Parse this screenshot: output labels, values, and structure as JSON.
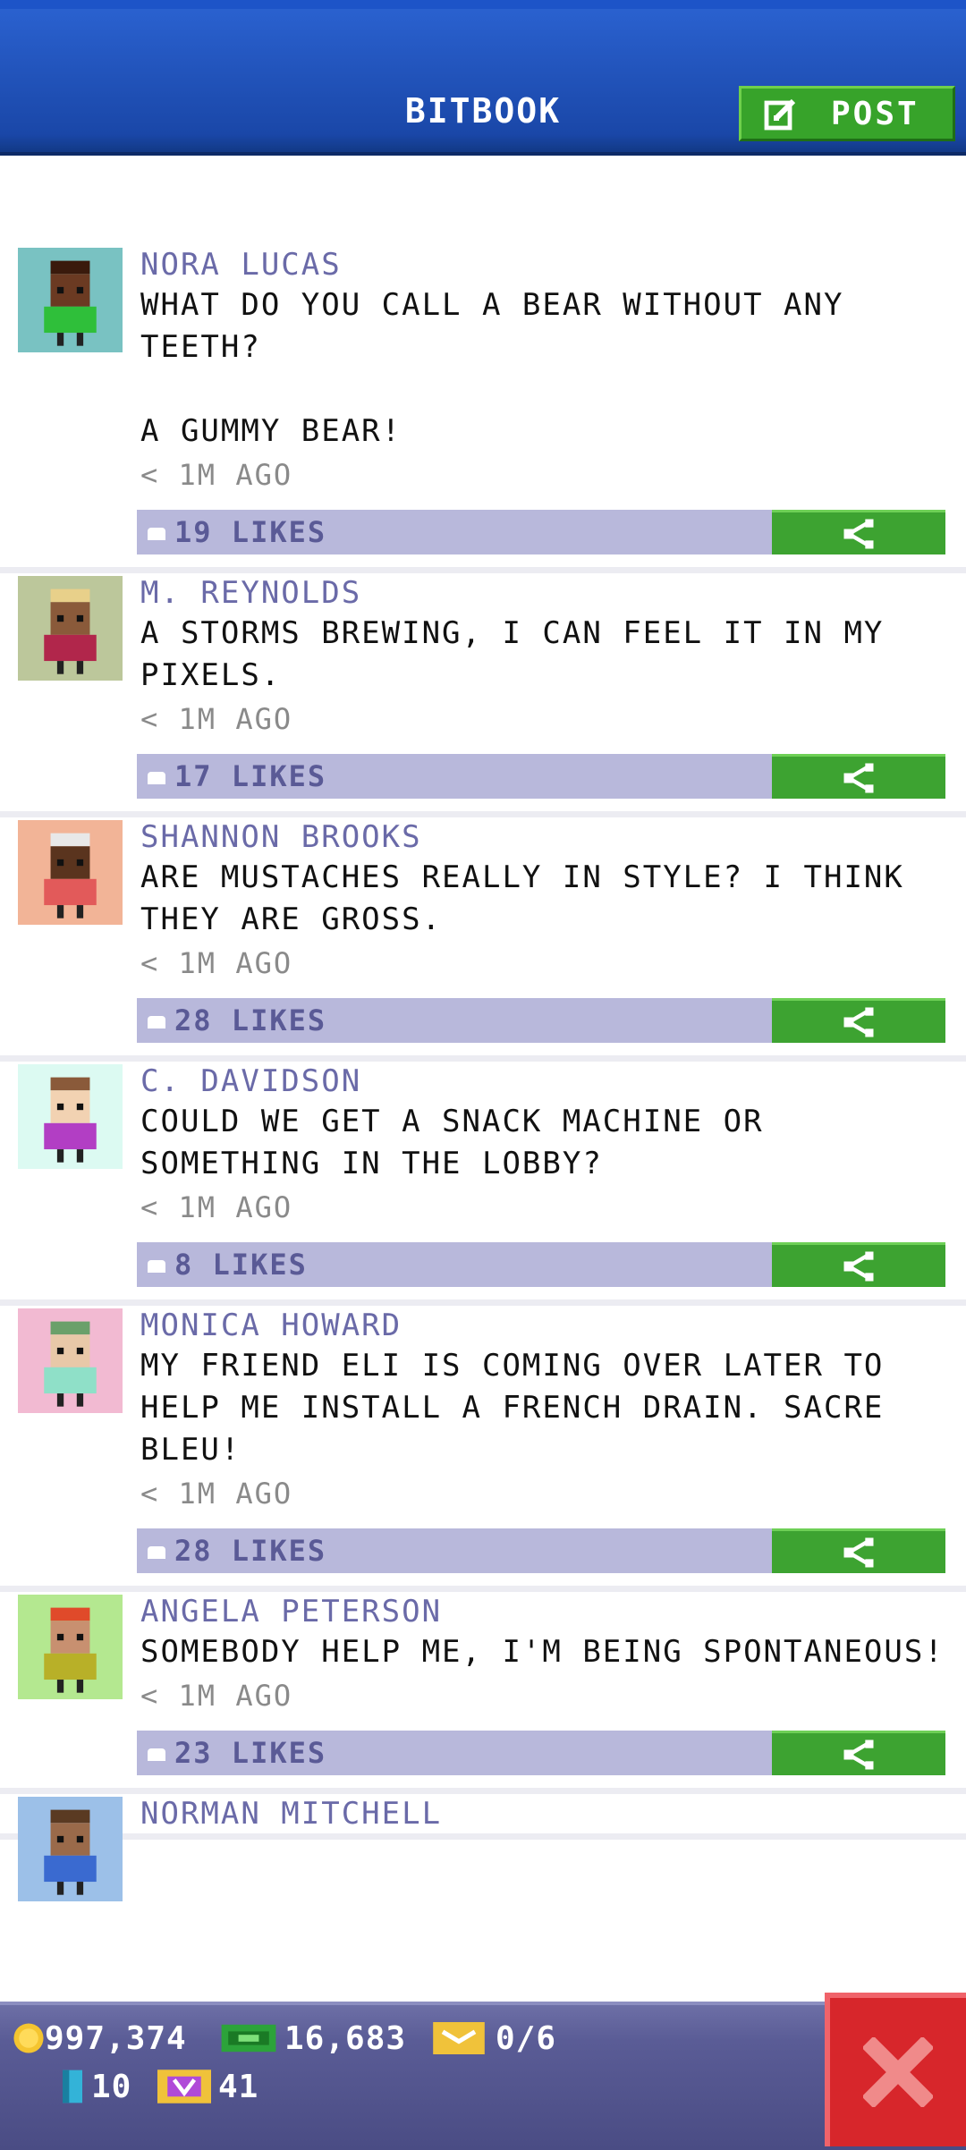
{
  "header": {
    "title": "BITBOOK",
    "post_label": "POST"
  },
  "posts": [
    {
      "author": "NORA LUCAS",
      "text": "WHAT DO YOU CALL A BEAR WITHOUT ANY TEETH?\n\nA GUMMY BEAR!",
      "time": "< 1M AGO",
      "likes": "19 LIKES",
      "avatar_bg": "#79c2c2",
      "shirt": "#2fbf3a",
      "skin": "#6b3a22",
      "hair": "#3a1a0c"
    },
    {
      "author": "M. REYNOLDS",
      "text": "A STORMS BREWING, I CAN FEEL IT IN MY PIXELS.",
      "time": "< 1M AGO",
      "likes": "17 LIKES",
      "avatar_bg": "#bcc79b",
      "shirt": "#b1264b",
      "skin": "#8a5a3a",
      "hair": "#e8d08a"
    },
    {
      "author": "SHANNON BROOKS",
      "text": "ARE MUSTACHES REALLY IN STYLE? I THINK THEY ARE GROSS.",
      "time": "< 1M AGO",
      "likes": "28 LIKES",
      "avatar_bg": "#f2b497",
      "shirt": "#e25a5a",
      "skin": "#5a341e",
      "hair": "#e8e8e8"
    },
    {
      "author": "C. DAVIDSON",
      "text": "COULD WE GET A SNACK MACHINE OR SOMETHING IN THE LOBBY?",
      "time": "< 1M AGO",
      "likes": "8 LIKES",
      "avatar_bg": "#dcfaf2",
      "shirt": "#b23ec4",
      "skin": "#f2d2b2",
      "hair": "#8a5a3a"
    },
    {
      "author": "MONICA HOWARD",
      "text": "MY FRIEND ELI IS COMING OVER LATER TO HELP ME INSTALL A FRENCH DRAIN. SACRE BLEU!",
      "time": "< 1M AGO",
      "likes": "28 LIKES",
      "avatar_bg": "#f2bad2",
      "shirt": "#8fe0c8",
      "skin": "#e8c8a8",
      "hair": "#6aa06a"
    },
    {
      "author": "ANGELA PETERSON",
      "text": "SOMEBODY HELP ME, I'M BEING SPONTANEOUS!",
      "time": "< 1M AGO",
      "likes": "23 LIKES",
      "avatar_bg": "#b4e890",
      "shirt": "#b8b028",
      "skin": "#c89070",
      "hair": "#e04a2a"
    },
    {
      "author": "NORMAN MITCHELL",
      "text": "",
      "time": "",
      "likes": "",
      "avatar_bg": "#9cc0e8",
      "shirt": "#3a6ad0",
      "skin": "#9a6a4a",
      "hair": "#5a3a22"
    }
  ],
  "status": {
    "coins": "997,374",
    "bux": "16,683",
    "tickets": "0/6",
    "stat_four": "10",
    "stat_five": "41"
  },
  "icons": {
    "post": "edit-icon",
    "share": "share-icon",
    "like": "like-icon",
    "coin": "coin-icon",
    "bux": "bux-icon",
    "ticket": "ticket-icon",
    "close": "close-icon"
  }
}
